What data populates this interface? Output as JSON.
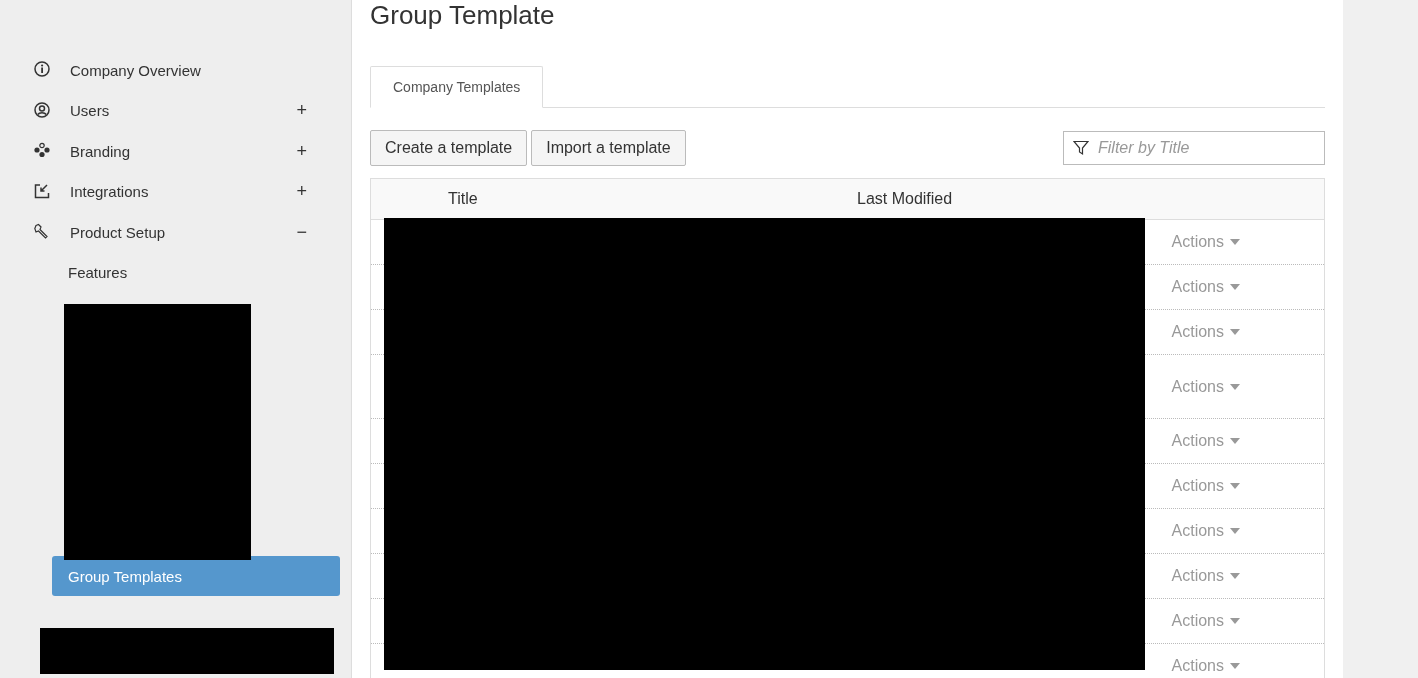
{
  "sidebar": {
    "items": [
      {
        "kind": "section",
        "label": "Company Overview",
        "selected": false
      },
      {
        "kind": "section",
        "label": "Users",
        "toggle": "+",
        "selected": false
      },
      {
        "kind": "section",
        "label": "Branding",
        "toggle": "+",
        "selected": false
      },
      {
        "kind": "section",
        "label": "Integrations",
        "toggle": "+",
        "selected": false
      },
      {
        "kind": "section",
        "label": "Product Setup",
        "toggle": "−",
        "selected": false
      },
      {
        "kind": "sub",
        "label": "Features",
        "selected": false
      },
      {
        "kind": "hidden"
      },
      {
        "kind": "sub",
        "label": "Group Templates",
        "selected": true
      }
    ]
  },
  "page": {
    "title": "Group Template",
    "tabs": [
      {
        "label": "Company Templates",
        "selected": true
      }
    ],
    "buttons": [
      "Create a template",
      "Import a template"
    ],
    "filter": {
      "placeholder": "Filter by Title"
    },
    "table": {
      "columns": [
        "Title",
        "Last Modified"
      ],
      "rows": [
        {
          "action": "Actions",
          "tall": false
        },
        {
          "action": "Actions",
          "tall": false
        },
        {
          "action": "Actions",
          "tall": false
        },
        {
          "action": "Actions",
          "tall": true
        },
        {
          "action": "Actions",
          "tall": false
        },
        {
          "action": "Actions",
          "tall": false
        },
        {
          "action": "Actions",
          "tall": false
        },
        {
          "action": "Actions",
          "tall": false
        },
        {
          "action": "Actions",
          "tall": false
        },
        {
          "action": "Actions",
          "tall": false
        }
      ]
    }
  },
  "redactions": [
    {
      "kind": "redaction"
    },
    {
      "kind": "redaction"
    },
    {
      "kind": "redaction"
    }
  ]
}
